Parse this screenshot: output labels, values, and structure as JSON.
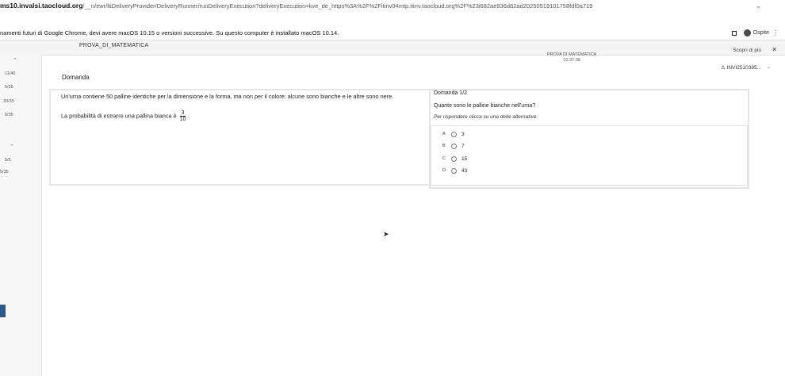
{
  "browser": {
    "url_host": "ms10.invalsi.taocloud.org",
    "url_path": "/__n/ewr/ltiDeliveryProvider/DeliveryRunner/runDeliveryExecution?deliveryExecution=kve_de_https%3A%2F%2Fitinv04mtp.itinv.taocloud.org%2F%23i682ae936d82ad20250519101758fdf0a719",
    "infobar_text": "namenti futuri di Google Chrome, devi avere macOS 10.15 o versioni successive. Su questo computer è installato macOS 10.14.",
    "guest_label": "Ospite"
  },
  "test": {
    "title": "PROVA_DI_MATEMATICA",
    "scopri": "Scopri di più",
    "center_label": "PROVA DI MATEMATICA",
    "timer": "01:37:08",
    "user": "INVI2510395..."
  },
  "sidebar": {
    "items": [
      "11/40",
      "5/35",
      "30/35",
      "0/35",
      "5/5",
      "5/35"
    ]
  },
  "question": {
    "name": "Domanda",
    "stem": "Un'urna contiene 50 palline identiche per la dimensione e la forma, ma non per il colore: alcune sono bianche e le altre sono nere.",
    "prob_text": "La probabilità di estrarre una pallina bianca è",
    "frac_num": "3",
    "frac_den": "10",
    "frac_after": "."
  },
  "response": {
    "header": "Domanda 1/2",
    "prompt": "Quante sono le palline bianche nell'urna?",
    "hint": "Per rispondere clicca su una delle alternative.",
    "choices": [
      {
        "letter": "A",
        "value": "3"
      },
      {
        "letter": "B",
        "value": "7"
      },
      {
        "letter": "C",
        "value": "15"
      },
      {
        "letter": "D",
        "value": "43"
      }
    ]
  }
}
